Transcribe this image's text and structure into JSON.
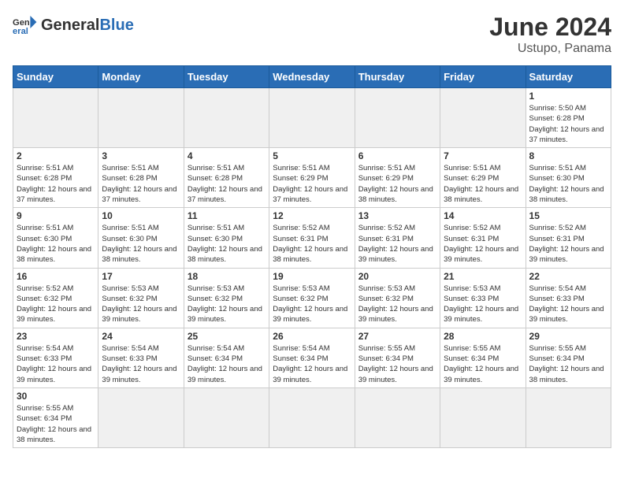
{
  "header": {
    "logo_general": "General",
    "logo_blue": "Blue",
    "month_title": "June 2024",
    "location": "Ustupo, Panama"
  },
  "days_of_week": [
    "Sunday",
    "Monday",
    "Tuesday",
    "Wednesday",
    "Thursday",
    "Friday",
    "Saturday"
  ],
  "weeks": [
    [
      {
        "day": "",
        "empty": true
      },
      {
        "day": "",
        "empty": true
      },
      {
        "day": "",
        "empty": true
      },
      {
        "day": "",
        "empty": true
      },
      {
        "day": "",
        "empty": true
      },
      {
        "day": "",
        "empty": true
      },
      {
        "day": "1",
        "sunrise": "5:50 AM",
        "sunset": "6:28 PM",
        "daylight": "12 hours and 37 minutes."
      }
    ],
    [
      {
        "day": "2",
        "sunrise": "5:51 AM",
        "sunset": "6:28 PM",
        "daylight": "12 hours and 37 minutes."
      },
      {
        "day": "3",
        "sunrise": "5:51 AM",
        "sunset": "6:28 PM",
        "daylight": "12 hours and 37 minutes."
      },
      {
        "day": "4",
        "sunrise": "5:51 AM",
        "sunset": "6:28 PM",
        "daylight": "12 hours and 37 minutes."
      },
      {
        "day": "5",
        "sunrise": "5:51 AM",
        "sunset": "6:29 PM",
        "daylight": "12 hours and 37 minutes."
      },
      {
        "day": "6",
        "sunrise": "5:51 AM",
        "sunset": "6:29 PM",
        "daylight": "12 hours and 38 minutes."
      },
      {
        "day": "7",
        "sunrise": "5:51 AM",
        "sunset": "6:29 PM",
        "daylight": "12 hours and 38 minutes."
      },
      {
        "day": "8",
        "sunrise": "5:51 AM",
        "sunset": "6:30 PM",
        "daylight": "12 hours and 38 minutes."
      }
    ],
    [
      {
        "day": "9",
        "sunrise": "5:51 AM",
        "sunset": "6:30 PM",
        "daylight": "12 hours and 38 minutes."
      },
      {
        "day": "10",
        "sunrise": "5:51 AM",
        "sunset": "6:30 PM",
        "daylight": "12 hours and 38 minutes."
      },
      {
        "day": "11",
        "sunrise": "5:51 AM",
        "sunset": "6:30 PM",
        "daylight": "12 hours and 38 minutes."
      },
      {
        "day": "12",
        "sunrise": "5:52 AM",
        "sunset": "6:31 PM",
        "daylight": "12 hours and 38 minutes."
      },
      {
        "day": "13",
        "sunrise": "5:52 AM",
        "sunset": "6:31 PM",
        "daylight": "12 hours and 39 minutes."
      },
      {
        "day": "14",
        "sunrise": "5:52 AM",
        "sunset": "6:31 PM",
        "daylight": "12 hours and 39 minutes."
      },
      {
        "day": "15",
        "sunrise": "5:52 AM",
        "sunset": "6:31 PM",
        "daylight": "12 hours and 39 minutes."
      }
    ],
    [
      {
        "day": "16",
        "sunrise": "5:52 AM",
        "sunset": "6:32 PM",
        "daylight": "12 hours and 39 minutes."
      },
      {
        "day": "17",
        "sunrise": "5:53 AM",
        "sunset": "6:32 PM",
        "daylight": "12 hours and 39 minutes."
      },
      {
        "day": "18",
        "sunrise": "5:53 AM",
        "sunset": "6:32 PM",
        "daylight": "12 hours and 39 minutes."
      },
      {
        "day": "19",
        "sunrise": "5:53 AM",
        "sunset": "6:32 PM",
        "daylight": "12 hours and 39 minutes."
      },
      {
        "day": "20",
        "sunrise": "5:53 AM",
        "sunset": "6:32 PM",
        "daylight": "12 hours and 39 minutes."
      },
      {
        "day": "21",
        "sunrise": "5:53 AM",
        "sunset": "6:33 PM",
        "daylight": "12 hours and 39 minutes."
      },
      {
        "day": "22",
        "sunrise": "5:54 AM",
        "sunset": "6:33 PM",
        "daylight": "12 hours and 39 minutes."
      }
    ],
    [
      {
        "day": "23",
        "sunrise": "5:54 AM",
        "sunset": "6:33 PM",
        "daylight": "12 hours and 39 minutes."
      },
      {
        "day": "24",
        "sunrise": "5:54 AM",
        "sunset": "6:33 PM",
        "daylight": "12 hours and 39 minutes."
      },
      {
        "day": "25",
        "sunrise": "5:54 AM",
        "sunset": "6:34 PM",
        "daylight": "12 hours and 39 minutes."
      },
      {
        "day": "26",
        "sunrise": "5:54 AM",
        "sunset": "6:34 PM",
        "daylight": "12 hours and 39 minutes."
      },
      {
        "day": "27",
        "sunrise": "5:55 AM",
        "sunset": "6:34 PM",
        "daylight": "12 hours and 39 minutes."
      },
      {
        "day": "28",
        "sunrise": "5:55 AM",
        "sunset": "6:34 PM",
        "daylight": "12 hours and 39 minutes."
      },
      {
        "day": "29",
        "sunrise": "5:55 AM",
        "sunset": "6:34 PM",
        "daylight": "12 hours and 38 minutes."
      }
    ],
    [
      {
        "day": "30",
        "sunrise": "5:55 AM",
        "sunset": "6:34 PM",
        "daylight": "12 hours and 38 minutes."
      },
      {
        "day": "",
        "empty": true
      },
      {
        "day": "",
        "empty": true
      },
      {
        "day": "",
        "empty": true
      },
      {
        "day": "",
        "empty": true
      },
      {
        "day": "",
        "empty": true
      },
      {
        "day": "",
        "empty": true
      }
    ]
  ]
}
